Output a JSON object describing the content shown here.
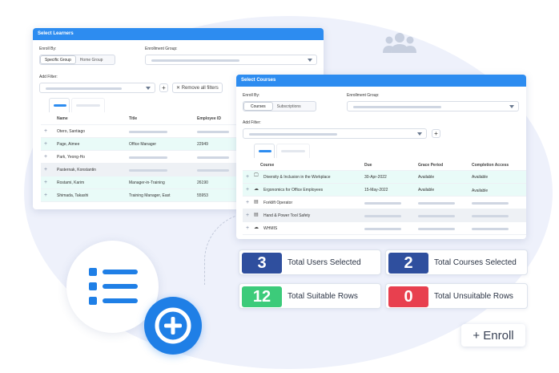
{
  "learners_panel": {
    "title": "Select Learners",
    "enroll_by_label": "Enroll By:",
    "enroll_by_options": [
      "Specific Group",
      "Home Group"
    ],
    "enrollment_group_label": "Enrollment Group:",
    "add_filter_label": "Add Filter:",
    "remove_filters_label": "✕ Remove all filters",
    "add_button": "+",
    "columns": [
      "Name",
      "Title",
      "Employee ID"
    ],
    "rows": [
      {
        "name": "Otero, Santiago",
        "title": "",
        "id": ""
      },
      {
        "name": "Page, Aimee",
        "title": "Office Manager",
        "id": "22949"
      },
      {
        "name": "Park, Yeong-Ho",
        "title": "",
        "id": ""
      },
      {
        "name": "Pasternak, Konstantin",
        "title": "",
        "id": ""
      },
      {
        "name": "Rostami, Karim",
        "title": "Manager-in-Training",
        "id": "26190"
      },
      {
        "name": "Shimada, Takashi",
        "title": "Training Manager, East",
        "id": "55953"
      }
    ]
  },
  "courses_panel": {
    "title": "Select Courses",
    "enroll_by_label": "Enroll By:",
    "enroll_by_options": [
      "Courses",
      "Subscriptions"
    ],
    "enrollment_group_label": "Enrollment Group:",
    "add_filter_label": "Add Filter:",
    "add_button": "+",
    "columns": [
      "Course",
      "Due",
      "Grace Period",
      "Completion Access"
    ],
    "rows": [
      {
        "course": "Diversity & Inclusion in the Workplace",
        "icon": "monitor-icon",
        "due": "30-Apr-2022",
        "grace": "Available",
        "access": "Available"
      },
      {
        "course": "Ergonomics for Office Employees",
        "icon": "cloud-icon",
        "due": "15-May-2022",
        "grace": "Available",
        "access": "Available"
      },
      {
        "course": "Forklift Operator",
        "icon": "certificate-icon",
        "due": "",
        "grace": "",
        "access": ""
      },
      {
        "course": "Hand & Power Tool Safety",
        "icon": "certificate-icon",
        "due": "",
        "grace": "",
        "access": ""
      },
      {
        "course": "WHMIS",
        "icon": "cloud-icon",
        "due": "",
        "grace": "",
        "access": ""
      }
    ]
  },
  "stats": [
    {
      "value": "3",
      "label": "Total Users Selected",
      "color": "#2f4f9e"
    },
    {
      "value": "2",
      "label": "Total Courses Selected",
      "color": "#2f4f9e"
    },
    {
      "value": "12",
      "label": "Total Suitable Rows",
      "color": "#3ccb7a"
    },
    {
      "value": "0",
      "label": "Total Unsuitable Rows",
      "color": "#e8404f"
    }
  ],
  "enroll_button": "+ Enroll",
  "colors": {
    "accent": "#2d8cf0",
    "highlight_row": "#e9fbf8",
    "background_blob": "#eef1fb"
  }
}
